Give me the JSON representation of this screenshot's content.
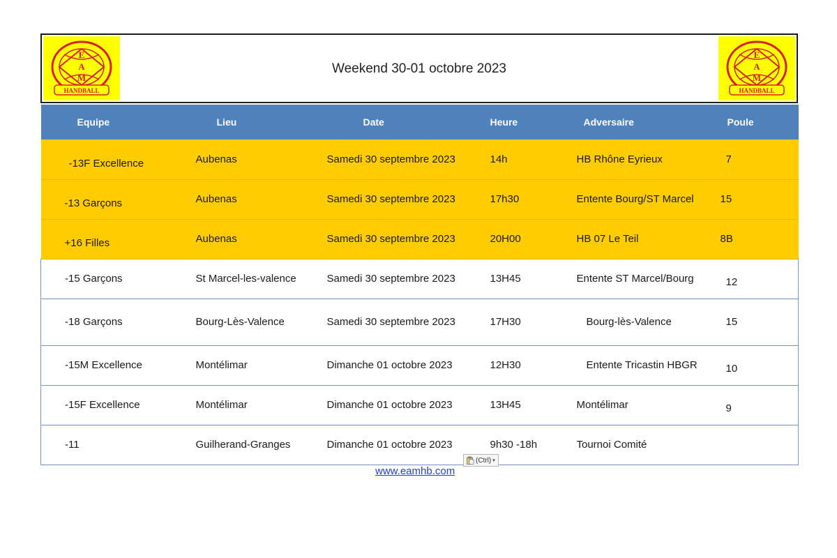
{
  "header": {
    "title": "Weekend 30-01 octobre 2023",
    "logo_left": {
      "text_top": "E",
      "text_mid": "A",
      "text_bot": "M",
      "banner": "HANDBALL"
    },
    "logo_right": {
      "text_top": "E",
      "text_mid": "A",
      "text_bot": "M",
      "banner": "HANDBALL"
    }
  },
  "table": {
    "columns": [
      "Equipe",
      "Lieu",
      "Date",
      "Heure",
      "Adversaire",
      "Poule"
    ],
    "rows": [
      {
        "equipe": "-13F Excellence",
        "lieu": "Aubenas",
        "date": "Samedi 30 septembre 2023",
        "heure": "14h",
        "adversaire": "HB Rhône Eyrieux",
        "poule": "7"
      },
      {
        "equipe": "-13 Garçons",
        "lieu": "Aubenas",
        "date": "Samedi 30 septembre 2023",
        "heure": "17h30",
        "adversaire": "Entente Bourg/ST Marcel",
        "poule": "15"
      },
      {
        "equipe": "+16 Filles",
        "lieu": "Aubenas",
        "date": "Samedi 30 septembre 2023",
        "heure": "20H00",
        "adversaire": "HB 07 Le Teil",
        "poule": "8B"
      },
      {
        "equipe": "-15 Garçons",
        "lieu": "St Marcel-les-valence",
        "date": "Samedi 30 septembre 2023",
        "heure": "13H45",
        "adversaire": "Entente ST Marcel/Bourg",
        "poule": "12"
      },
      {
        "equipe": "-18 Garçons",
        "lieu": "Bourg-Lès-Valence",
        "date": "Samedi 30 septembre 2023",
        "heure": "17H30",
        "adversaire": "Bourg-lès-Valence",
        "poule": "15"
      },
      {
        "equipe": "-15M Excellence",
        "lieu": "Montélimar",
        "date": "Dimanche 01 octobre 2023",
        "heure": "12H30",
        "adversaire": "Entente Tricastin HBGR",
        "poule": "10"
      },
      {
        "equipe": "-15F Excellence",
        "lieu": "Montélimar",
        "date": "Dimanche 01 octobre 2023",
        "heure": "13H45",
        "adversaire": "Montélimar",
        "poule": "9"
      },
      {
        "equipe": "-11",
        "lieu": "Guilherand-Granges",
        "date": "Dimanche 01 octobre 2023",
        "heure": "9h30 -18h",
        "adversaire": "Tournoi Comité",
        "poule": ""
      }
    ]
  },
  "footer": {
    "link_text": "www.eamhb.com",
    "paste_label": "(Ctrl)",
    "paste_icon": "clipboard-icon"
  },
  "colors": {
    "header_blue": "#4f81bd",
    "highlight_yellow": "#ffcc00",
    "logo_yellow": "#ffff00",
    "logo_red": "#d62020"
  }
}
